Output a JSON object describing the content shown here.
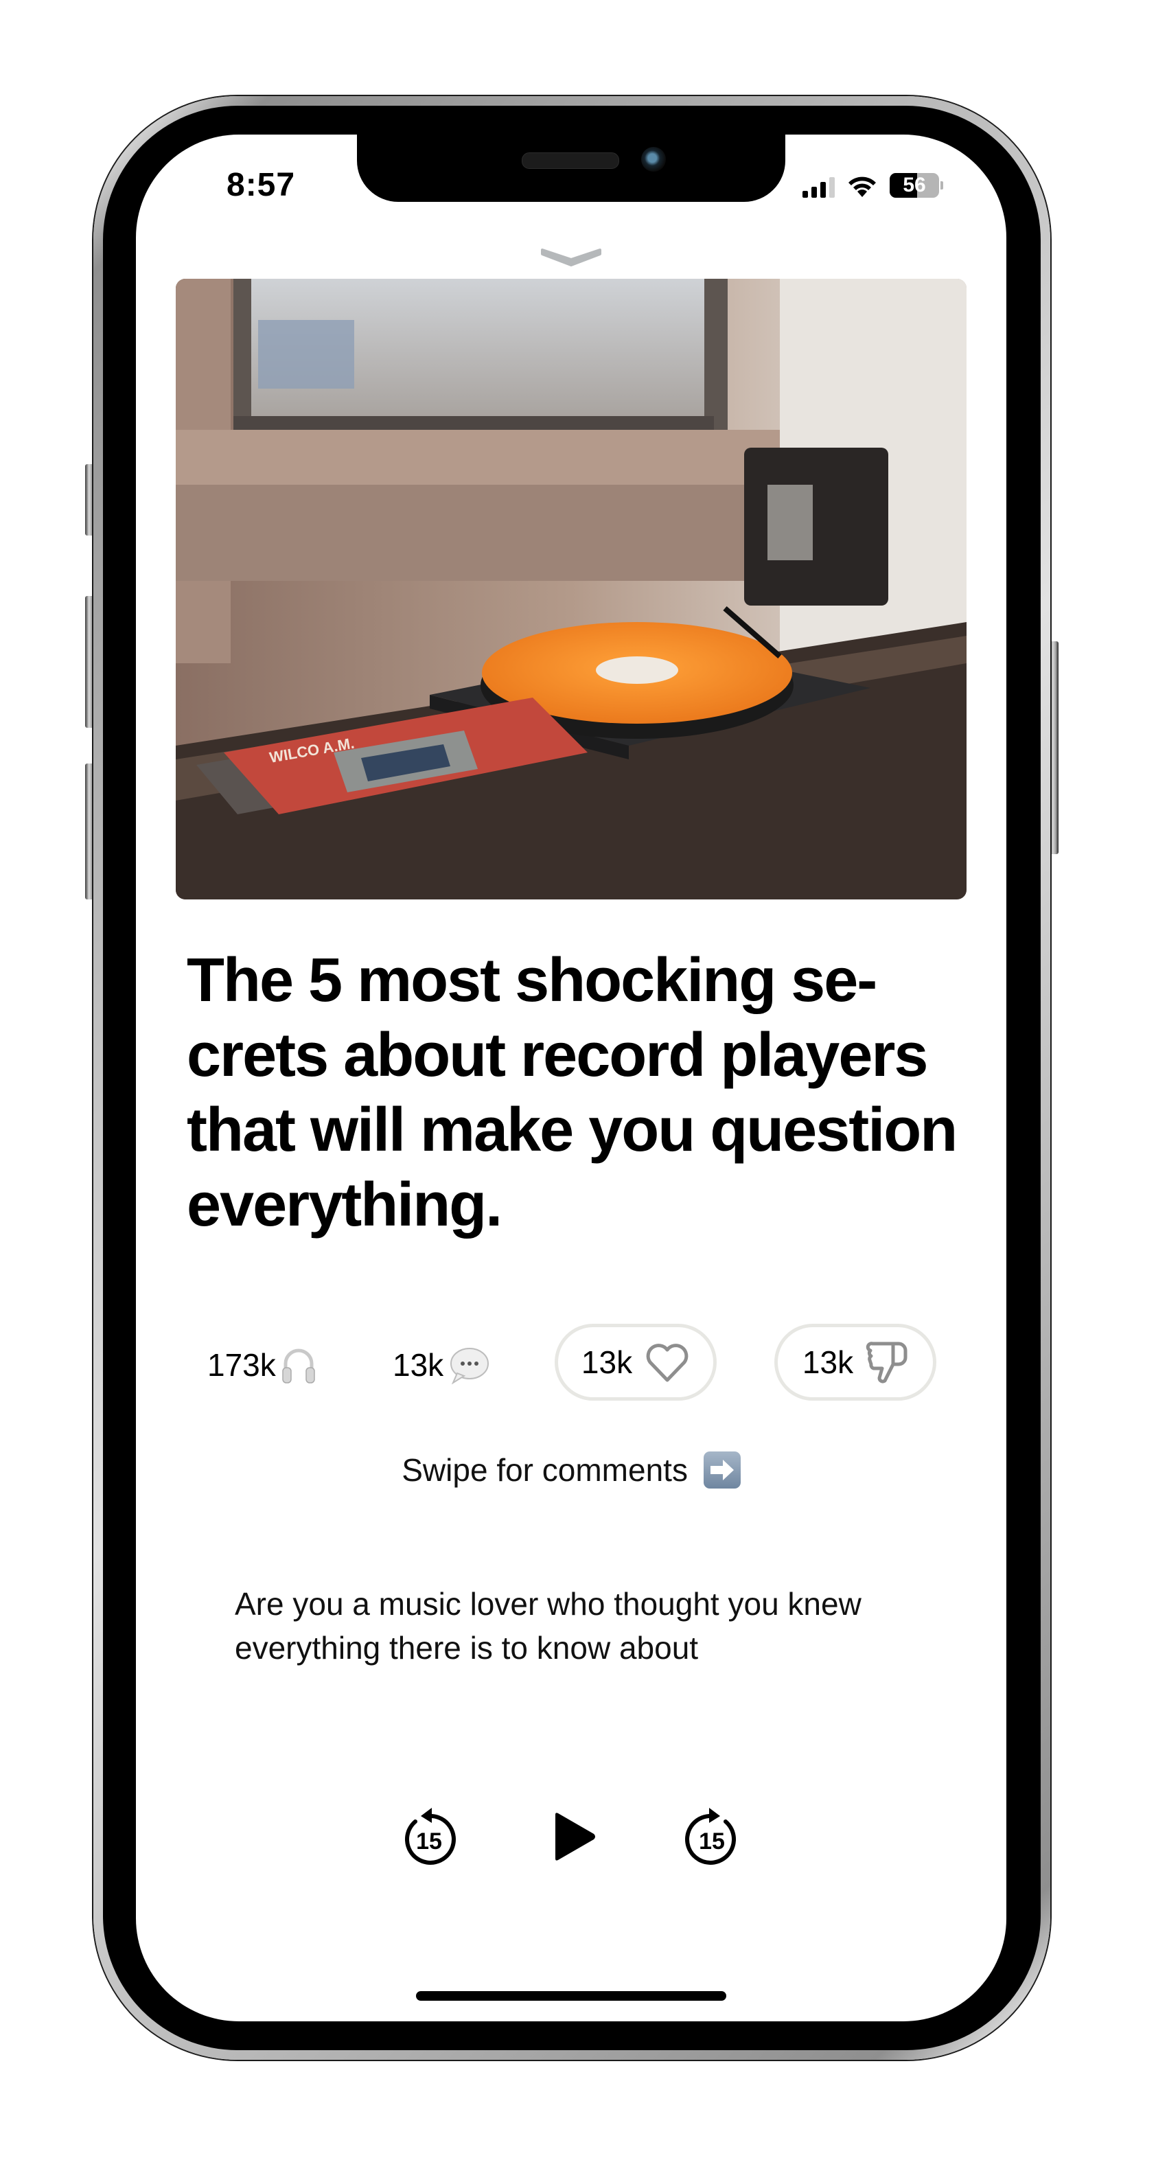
{
  "status_bar": {
    "time": "8:57",
    "battery_percent": 56,
    "battery_label": "56",
    "signal_bars_active": 3,
    "signal_bars_total": 4,
    "icons": [
      "cellular-signal-icon",
      "wifi-icon",
      "battery-icon"
    ]
  },
  "sheet": {
    "grabber_icon": "chevron-down-icon"
  },
  "article": {
    "hero_image_alt": "Orange vinyl record on a turntable next to a window with a WILCO A.M. album",
    "title": "The 5 most shocking se-crets about record players that will make you question everything.",
    "stats": {
      "listens": {
        "value": "173k",
        "icon": "headphones-icon"
      },
      "comments": {
        "value": "13k",
        "icon": "speech-bubble-icon"
      },
      "likes": {
        "value": "13k",
        "icon": "heart-icon"
      },
      "dislikes": {
        "value": "13k",
        "icon": "thumbs-down-icon"
      }
    },
    "swipe_hint": "Swipe for comments",
    "swipe_icon": "right-arrow-icon",
    "body_preview": "Are you a music lover who thought you knew everything there is to know about"
  },
  "player": {
    "skip_back_seconds": "15",
    "skip_forward_seconds": "15",
    "play_icon": "play-icon"
  },
  "colors": {
    "text": "#000000",
    "pill_border": "#e7e7e3",
    "icon_grey": "#8e8e8e",
    "grabber": "#b5b8ba",
    "vinyl_orange": "#f08a24"
  }
}
